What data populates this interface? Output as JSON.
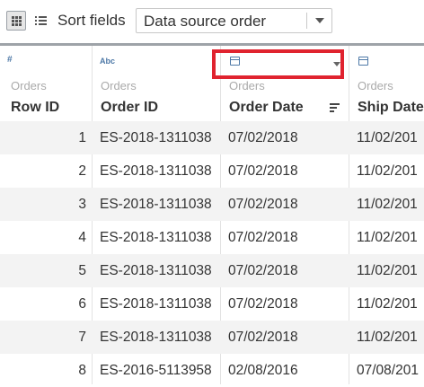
{
  "toolbar": {
    "grid_icon": "grid-view-icon",
    "list_icon": "list-view-icon",
    "sort_label": "Sort fields",
    "sort_value": "Data source order"
  },
  "columns": [
    {
      "type_icon": "number-icon",
      "type_glyph": "#",
      "source": "Orders",
      "name": "Row ID"
    },
    {
      "type_icon": "string-icon",
      "type_glyph": "Abc",
      "source": "Orders",
      "name": "Order ID"
    },
    {
      "type_icon": "calendar-icon",
      "type_glyph": "",
      "source": "Orders",
      "name": "Order Date"
    },
    {
      "type_icon": "calendar-icon",
      "type_glyph": "",
      "source": "Orders",
      "name": "Ship Date"
    }
  ],
  "rows": [
    {
      "row_id": "1",
      "order_id": "ES-2018-1311038",
      "order_date": "07/02/2018",
      "ship_date": "11/02/201"
    },
    {
      "row_id": "2",
      "order_id": "ES-2018-1311038",
      "order_date": "07/02/2018",
      "ship_date": "11/02/201"
    },
    {
      "row_id": "3",
      "order_id": "ES-2018-1311038",
      "order_date": "07/02/2018",
      "ship_date": "11/02/201"
    },
    {
      "row_id": "4",
      "order_id": "ES-2018-1311038",
      "order_date": "07/02/2018",
      "ship_date": "11/02/201"
    },
    {
      "row_id": "5",
      "order_id": "ES-2018-1311038",
      "order_date": "07/02/2018",
      "ship_date": "11/02/201"
    },
    {
      "row_id": "6",
      "order_id": "ES-2018-1311038",
      "order_date": "07/02/2018",
      "ship_date": "11/02/201"
    },
    {
      "row_id": "7",
      "order_id": "ES-2018-1311038",
      "order_date": "07/02/2018",
      "ship_date": "11/02/201"
    },
    {
      "row_id": "8",
      "order_id": "ES-2016-5113958",
      "order_date": "02/08/2016",
      "ship_date": "07/08/201"
    }
  ],
  "colors": {
    "highlight_box": "#e0232f",
    "type_icon": "#4e79a7",
    "alt_row": "#f3f3f3"
  }
}
